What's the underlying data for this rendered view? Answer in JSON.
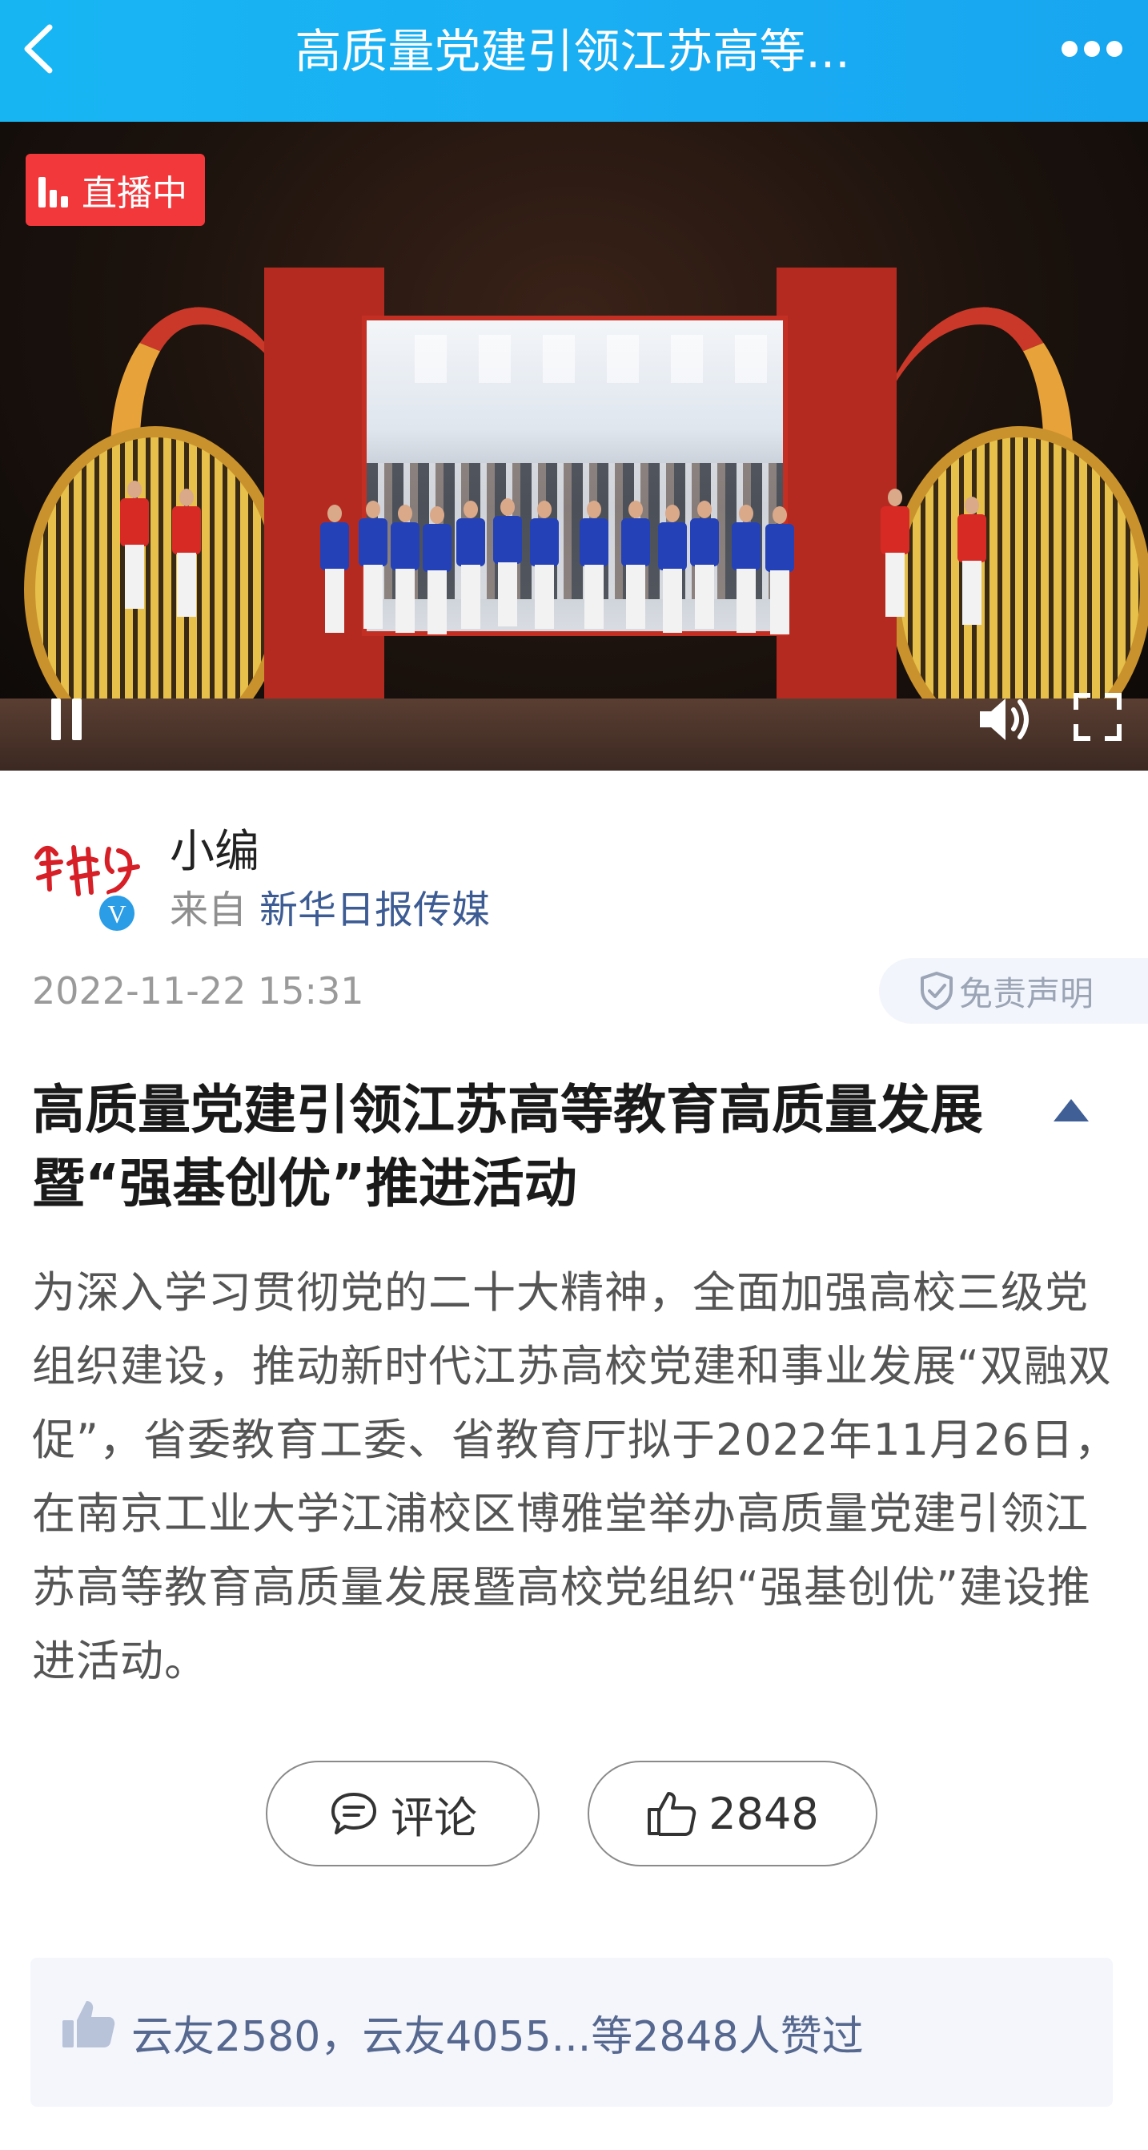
{
  "header": {
    "title": "高质量党建引领江苏高等...",
    "background": "#1aaef3"
  },
  "video": {
    "live_label": "直播中",
    "live_badge_color": "#f2383a",
    "controls": [
      "pause-icon",
      "volume-icon",
      "fullscreen-icon"
    ]
  },
  "author": {
    "name": "小编",
    "source_prefix": "来自",
    "source": "新华日报传媒",
    "logo_text": "新华红",
    "verified": true
  },
  "meta": {
    "timestamp": "2022-11-22 15:31",
    "disclaimer": "免责声明"
  },
  "article": {
    "title": "高质量党建引领江苏高等教育高质量发展暨“强基创优”推进活动",
    "body": "为深入学习贯彻党的二十大精神，全面加强高校三级党组织建设，推动新时代江苏高校党建和事业发展“双融双促”，省委教育工委、省教育厅拟于2022年11月26日，在南京工业大学江浦校区博雅堂举办高质量党建引领江苏高等教育高质量发展暨高校党组织“强基创优”建设推进活动。"
  },
  "actions": {
    "comment_label": "评论",
    "like_count": "2848"
  },
  "likes": {
    "text": "云友2580，云友4055...等2848人赞过"
  }
}
